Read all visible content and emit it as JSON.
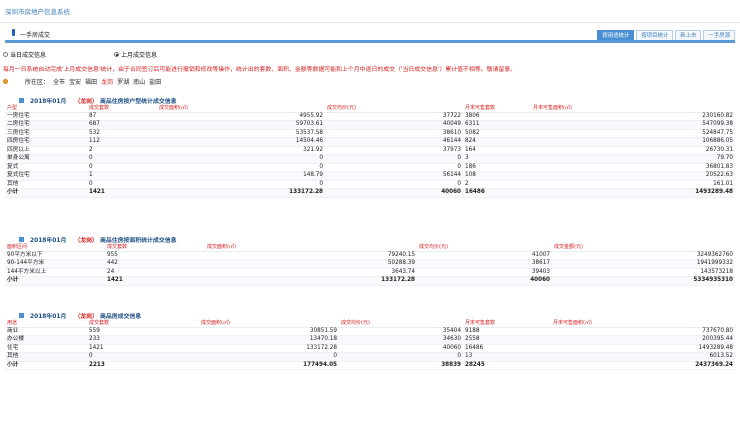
{
  "site_title": "深圳市房地产信息系统",
  "section_title": "一手房成交",
  "tabs": [
    "按用途统计",
    "按项目统计",
    "新上市",
    "一手房源"
  ],
  "radios": [
    "当日成交信息",
    "上月成交信息"
  ],
  "notice": "每月一日系统自动完成'上月成交信息'统计，由于合同签订后可能进行撤销和修改等操作，统计出的套数、面积、金额等数据可能和上个月中逐日的成交（'当日成交信息'）累计值不相等。敬请留意。",
  "region": {
    "label": "所在区：",
    "districts": [
      "全市",
      "宝安",
      "福田",
      "龙岗",
      "罗湖",
      "南山",
      "盐田"
    ],
    "selected": "龙岗"
  },
  "table1": {
    "period": "2018年01月",
    "district": "（龙岗）",
    "title": "商品住房按户型统计成交信息",
    "headers": [
      "户型",
      "成交套数",
      "成交面积(㎡)",
      "成交均价(元)",
      "月末可售套数",
      "月末可售面积(㎡)"
    ],
    "rows": [
      [
        "一房住宅",
        "87",
        "4955.92",
        "37722",
        "3806",
        "230160.82"
      ],
      [
        "二房住宅",
        "687",
        "59703.61",
        "40049",
        "6311",
        "547099.38"
      ],
      [
        "三房住宅",
        "532",
        "53537.58",
        "38610",
        "5082",
        "524847.75"
      ],
      [
        "四房住宅",
        "112",
        "14504.46",
        "46144",
        "824",
        "106886.05"
      ],
      [
        "四房以上",
        "2",
        "321.92",
        "37973",
        "164",
        "26730.31"
      ],
      [
        "单身公寓",
        "0",
        "0",
        "0",
        "3",
        "79.70"
      ],
      [
        "复式",
        "0",
        "0",
        "0",
        "186",
        "36801.83"
      ],
      [
        "复式住宅",
        "1",
        "148.79",
        "56144",
        "108",
        "20522.63"
      ],
      [
        "其他",
        "0",
        "0",
        "0",
        "2",
        "161.01"
      ],
      [
        "小计",
        "1421",
        "133172.28",
        "40060",
        "16486",
        "1493289.48"
      ]
    ]
  },
  "table2": {
    "period": "2018年01月",
    "district": "（龙岗）",
    "title": "商品住房按面积统计成交信息",
    "headers": [
      "面积区间",
      "成交套数",
      "成交面积(㎡)",
      "成交均价(元)",
      "成交金额(元)"
    ],
    "rows": [
      [
        "90平方米以下",
        "955",
        "79240.15",
        "41007",
        "3249362760"
      ],
      [
        "90-144平方米",
        "442",
        "50288.39",
        "38617",
        "1941999332"
      ],
      [
        "144平方米以上",
        "24",
        "3643.74",
        "39403",
        "143573218"
      ],
      [
        "小计",
        "1421",
        "133172.28",
        "40060",
        "5334935310"
      ]
    ]
  },
  "table3": {
    "period": "2018年01月",
    "district": "（龙岗）",
    "title": "商品房成交信息",
    "headers": [
      "用途",
      "成交套数",
      "成交面积(㎡)",
      "成交均价(元)",
      "月末可售套数",
      "月末可售面积(㎡)"
    ],
    "rows": [
      [
        "商业",
        "559",
        "30851.59",
        "35404",
        "9188",
        "737670.80"
      ],
      [
        "办公楼",
        "233",
        "13470.18",
        "34630",
        "2558",
        "200395.44"
      ],
      [
        "住宅",
        "1421",
        "133172.28",
        "40060",
        "16486",
        "1493289.48"
      ],
      [
        "其他",
        "0",
        "0",
        "0",
        "13",
        "6013.52"
      ],
      [
        "小计",
        "2213",
        "177494.05",
        "38839",
        "28245",
        "2437369.24"
      ]
    ]
  }
}
